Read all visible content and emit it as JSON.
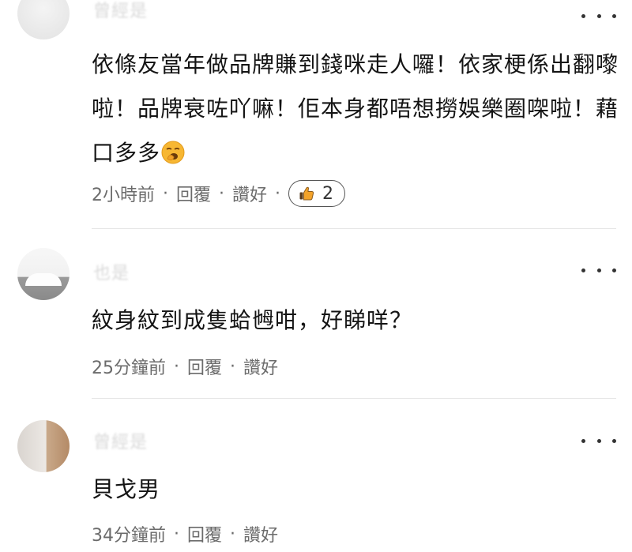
{
  "comments": [
    {
      "username": "曾經是",
      "text_before_emoji": "依條友當年做品牌賺到錢咪走人囉！依家梗係出翻嚟啦！品牌衰咗吖嘛！佢本身都唔想撈娛樂圈㗎啦！藉口多多",
      "emoji": "yawning-face-emoji",
      "time": "2小時前",
      "reply_label": "回覆",
      "like_label": "讚好",
      "like_count": "2",
      "like_icon": "thumbs-up-icon"
    },
    {
      "username": "也是",
      "text": "紋身紋到成隻蛤乸咁，好睇咩？",
      "time": "25分鐘前",
      "reply_label": "回覆",
      "like_label": "讚好"
    },
    {
      "username": "曾經是",
      "text": "貝戈男",
      "time": "34分鐘前",
      "reply_label": "回覆",
      "like_label": "讚好"
    }
  ],
  "separator": "·",
  "colors": {
    "meta_text": "#6b6b6b",
    "body_text": "#141414",
    "divider": "#e6e6e6",
    "emoji_yellow": "#f7b733"
  }
}
